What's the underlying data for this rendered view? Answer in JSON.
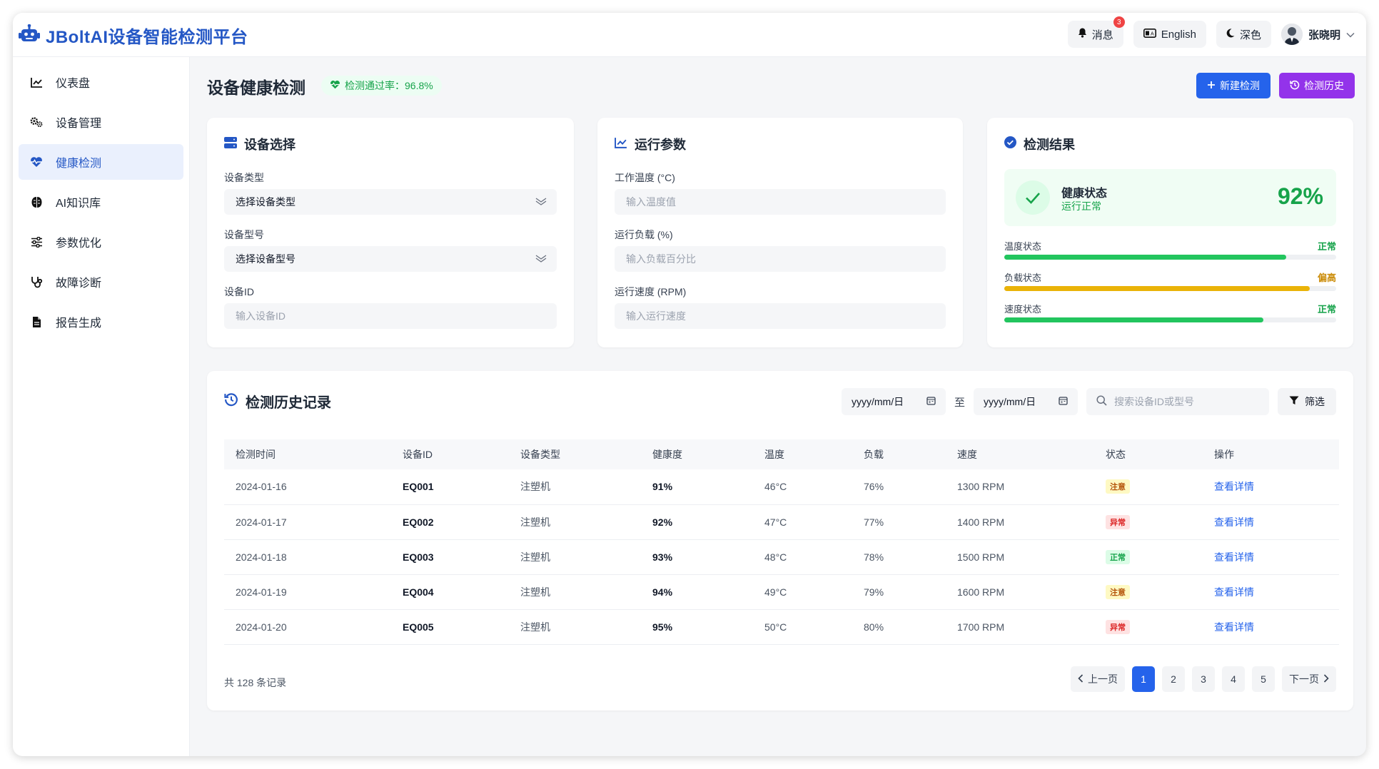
{
  "app": {
    "title": "JBoltAI设备智能检测平台"
  },
  "topbar": {
    "messages_label": "消息",
    "messages_count": "3",
    "language_label": "English",
    "theme_label": "深色",
    "user_name": "张晓明"
  },
  "sidebar": {
    "items": [
      {
        "label": "仪表盘",
        "icon": "chart-line-icon"
      },
      {
        "label": "设备管理",
        "icon": "gears-icon"
      },
      {
        "label": "健康检测",
        "icon": "heartbeat-icon",
        "active": true
      },
      {
        "label": "AI知识库",
        "icon": "brain-icon"
      },
      {
        "label": "参数优化",
        "icon": "sliders-icon"
      },
      {
        "label": "故障诊断",
        "icon": "stethoscope-icon"
      },
      {
        "label": "报告生成",
        "icon": "file-icon"
      }
    ]
  },
  "page": {
    "title": "设备健康检测",
    "pass_rate": "检测通过率：96.8%",
    "new_button": "新建检测",
    "history_button": "检测历史"
  },
  "device_select": {
    "title": "设备选择",
    "type_label": "设备类型",
    "type_value": "选择设备类型",
    "model_label": "设备型号",
    "model_value": "选择设备型号",
    "id_label": "设备ID",
    "id_placeholder": "输入设备ID"
  },
  "params": {
    "title": "运行参数",
    "temp_label": "工作温度 (°C)",
    "temp_placeholder": "输入温度值",
    "load_label": "运行负载 (%)",
    "load_placeholder": "输入负载百分比",
    "speed_label": "运行速度 (RPM)",
    "speed_placeholder": "输入运行速度"
  },
  "result": {
    "title": "检测结果",
    "status_title": "健康状态",
    "status_sub": "运行正常",
    "score": "92%",
    "metrics": [
      {
        "label": "温度状态",
        "value": "正常",
        "level": 0.85,
        "color": "#22c55e",
        "text_color": "#16a34a"
      },
      {
        "label": "负载状态",
        "value": "偏高",
        "level": 0.92,
        "color": "#eab308",
        "text_color": "#ca8a04"
      },
      {
        "label": "速度状态",
        "value": "正常",
        "level": 0.78,
        "color": "#22c55e",
        "text_color": "#16a34a"
      }
    ]
  },
  "history": {
    "title": "检测历史记录",
    "date_from": "yyyy/mm/日",
    "to_label": "至",
    "date_to": "yyyy/mm/日",
    "search_placeholder": "搜索设备ID或型号",
    "filter_label": "筛选",
    "columns": [
      "检测时间",
      "设备ID",
      "设备类型",
      "健康度",
      "温度",
      "负载",
      "速度",
      "状态",
      "操作"
    ],
    "rows": [
      {
        "time": "2024-01-16",
        "id": "EQ001",
        "type": "注塑机",
        "health": "91%",
        "temp": "46°C",
        "load": "76%",
        "speed": "1300 RPM",
        "status": "注意",
        "status_kind": "warn",
        "action": "查看详情"
      },
      {
        "time": "2024-01-17",
        "id": "EQ002",
        "type": "注塑机",
        "health": "92%",
        "temp": "47°C",
        "load": "77%",
        "speed": "1400 RPM",
        "status": "异常",
        "status_kind": "err",
        "action": "查看详情"
      },
      {
        "time": "2024-01-18",
        "id": "EQ003",
        "type": "注塑机",
        "health": "93%",
        "temp": "48°C",
        "load": "78%",
        "speed": "1500 RPM",
        "status": "正常",
        "status_kind": "ok",
        "action": "查看详情"
      },
      {
        "time": "2024-01-19",
        "id": "EQ004",
        "type": "注塑机",
        "health": "94%",
        "temp": "49°C",
        "load": "79%",
        "speed": "1600 RPM",
        "status": "注意",
        "status_kind": "warn",
        "action": "查看详情"
      },
      {
        "time": "2024-01-20",
        "id": "EQ005",
        "type": "注塑机",
        "health": "95%",
        "temp": "50°C",
        "load": "80%",
        "speed": "1700 RPM",
        "status": "异常",
        "status_kind": "err",
        "action": "查看详情"
      }
    ],
    "total": "共 128 条记录",
    "prev": "上一页",
    "next": "下一页",
    "pages": [
      "1",
      "2",
      "3",
      "4",
      "5"
    ],
    "current_page": "1"
  }
}
